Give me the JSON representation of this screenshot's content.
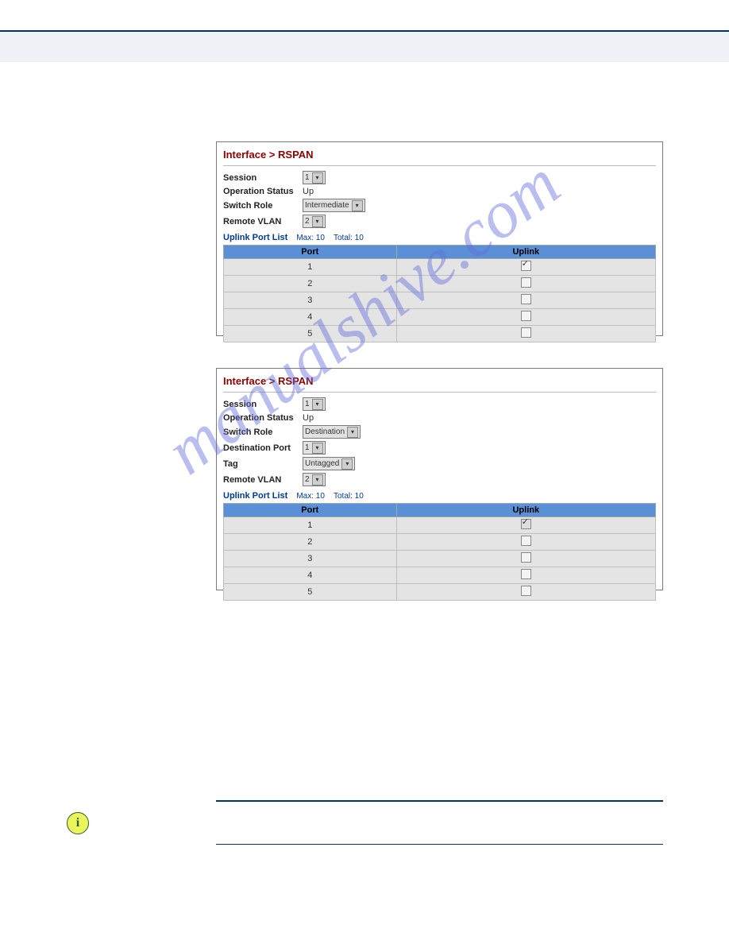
{
  "watermark_text": "manualshive.com",
  "info_icon_glyph": "i",
  "panel1": {
    "breadcrumb": "Interface > RSPAN",
    "session_label": "Session",
    "session_value": "1",
    "opstatus_label": "Operation Status",
    "opstatus_value": "Up",
    "role_label": "Switch Role",
    "role_value": "Intermediate",
    "rvlan_label": "Remote VLAN",
    "rvlan_value": "2",
    "uplink_title": "Uplink Port List",
    "uplink_max": "Max: 10",
    "uplink_total": "Total: 10",
    "col_port": "Port",
    "col_uplink": "Uplink",
    "rows": [
      {
        "port": "1",
        "checked": "true"
      },
      {
        "port": "2",
        "checked": "false"
      },
      {
        "port": "3",
        "checked": "false"
      },
      {
        "port": "4",
        "checked": "false"
      },
      {
        "port": "5",
        "checked": "false"
      }
    ]
  },
  "panel2": {
    "breadcrumb": "Interface > RSPAN",
    "session_label": "Session",
    "session_value": "1",
    "opstatus_label": "Operation Status",
    "opstatus_value": "Up",
    "role_label": "Switch Role",
    "role_value": "Destination",
    "dport_label": "Destination Port",
    "dport_value": "1",
    "tag_label": "Tag",
    "tag_value": "Untagged",
    "rvlan_label": "Remote VLAN",
    "rvlan_value": "2",
    "uplink_title": "Uplink Port List",
    "uplink_max": "Max: 10",
    "uplink_total": "Total: 10",
    "col_port": "Port",
    "col_uplink": "Uplink",
    "rows": [
      {
        "port": "1",
        "checked": "true",
        "disabled": "true"
      },
      {
        "port": "2",
        "checked": "false"
      },
      {
        "port": "3",
        "checked": "false"
      },
      {
        "port": "4",
        "checked": "false"
      },
      {
        "port": "5",
        "checked": "false"
      }
    ]
  }
}
